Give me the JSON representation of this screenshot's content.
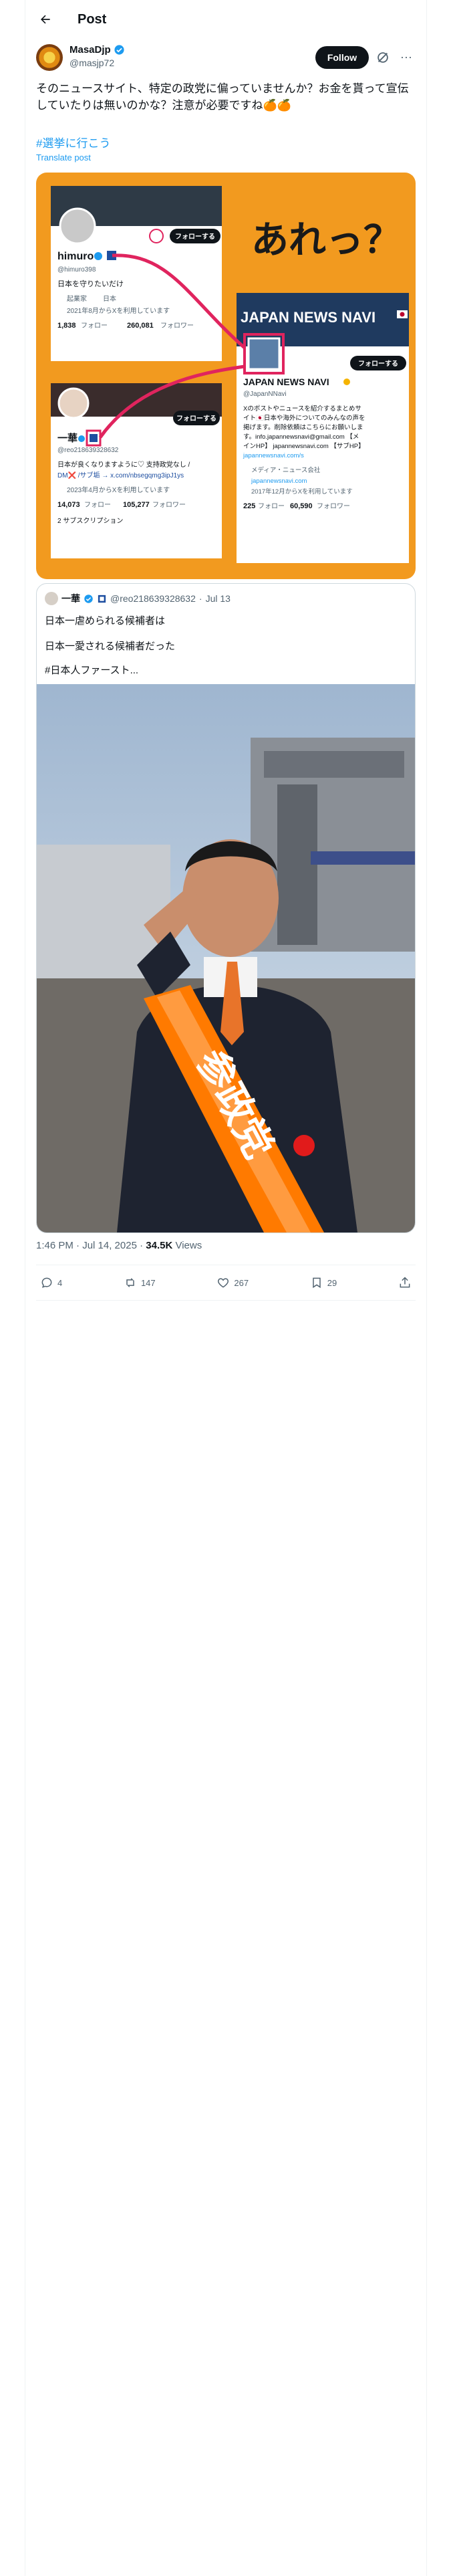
{
  "header": {
    "title": "Post"
  },
  "author": {
    "display_name": "MasaDjp",
    "handle": "@masjp72",
    "follow_label": "Follow"
  },
  "post": {
    "text": "そのニュースサイト、特定の政党に偏っていませんか？お金を貰って宣伝していたりは無いのかな？注意が必要ですね🍊🍊",
    "hashtag": "#選挙に行こう",
    "translate_label": "Translate post"
  },
  "embedded_image": {
    "headline": "あれっ？",
    "left_card1": {
      "name": "himuro",
      "handle": "@himuro398",
      "follow_label": "フォローする",
      "bio": "日本を守りたいだけ",
      "meta1": "起業家",
      "meta2": "日本",
      "joined": "2021年8月からXを利用しています",
      "following_count": "1,838",
      "following_label": "フォロー",
      "followers_count": "260,081",
      "followers_label": "フォロワー"
    },
    "left_card2": {
      "name": "一華",
      "handle": "@reo218639328632",
      "follow_label": "フォローする",
      "bio_line1": "日本が良くなりますように♡ 支持政党なし /",
      "bio_line2": "DM❌ /サブ垢 → x.com/nbsegqmg3ipJ1ys",
      "joined": "2023年4月からXを利用しています",
      "following_count": "14,073",
      "following_label": "フォロー",
      "followers_count": "105,277",
      "followers_label": "フォロワー",
      "subs": "2 サブスクリプション"
    },
    "right_card": {
      "banner": "JAPAN NEWS NAVI",
      "follow_label": "フォローする",
      "name": "JAPAN NEWS NAVI",
      "handle": "@JapanNNavi",
      "bio_l1": "Xのポストやニュースを紹介するまとめサ",
      "bio_l2": "イト🇯🇵日本や海外についてのみんなの声を",
      "bio_l3": "掲げます。削除依頼はこちらにお願いしま",
      "bio_l4": "す。info.japannewsnavi@gmail.com 【メ",
      "bio_l5": "インHP】 japannewsnavi.com 【サブHP】",
      "bio_l6": "japannewsnavi.com/s",
      "category": "メディア・ニュース会社",
      "link": "japannewsnavi.com",
      "joined": "2017年12月からXを利用しています",
      "following_count": "225",
      "following_label": "フォロー",
      "followers_count": "60,590",
      "followers_label": "フォロワー"
    }
  },
  "quote": {
    "name": "一華",
    "handle": "@reo218639328632",
    "dot": "·",
    "date": "Jul 13",
    "line1": "日本一虐められる候補者は",
    "line2": "日本一愛される候補者だった",
    "line3": "#日本人ファースト...",
    "sash_text": "参政党"
  },
  "meta": {
    "time": "1:46 PM · Jul 14, 2025 · ",
    "views_count": "34.5K",
    "views_label": " Views"
  },
  "actions": {
    "replies": "4",
    "reposts": "147",
    "likes": "267",
    "bookmarks": "29"
  },
  "colors": {
    "accent": "#1d9bf0",
    "image_bg": "#f29a1f",
    "sash": "#ff7a00"
  }
}
